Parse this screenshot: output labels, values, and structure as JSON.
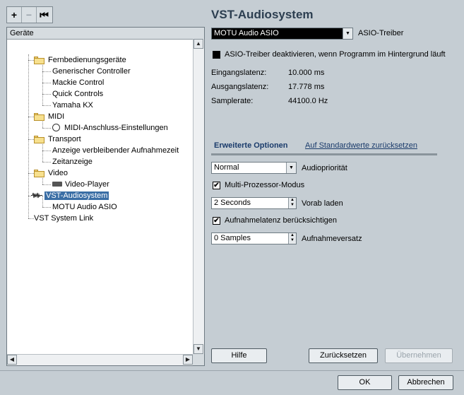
{
  "toolbar": {
    "add": "+",
    "remove": "−",
    "reset": "⏮"
  },
  "tree": {
    "header": "Geräte",
    "items": [
      {
        "label": "Fernbedienungsgeräte"
      },
      {
        "label": "Generischer Controller"
      },
      {
        "label": "Mackie Control"
      },
      {
        "label": "Quick Controls"
      },
      {
        "label": "Yamaha KX"
      },
      {
        "label": "MIDI"
      },
      {
        "label": "MIDI-Anschluss-Einstellungen"
      },
      {
        "label": "Transport"
      },
      {
        "label": "Anzeige verbleibender Aufnahmezeit"
      },
      {
        "label": "Zeitanzeige"
      },
      {
        "label": "Video"
      },
      {
        "label": "Video-Player"
      },
      {
        "label": "VST-Audiosystem"
      },
      {
        "label": "MOTU Audio ASIO"
      },
      {
        "label": "VST System Link"
      }
    ]
  },
  "main": {
    "title": "VST-Audiosystem",
    "driver_value": "MOTU Audio ASIO",
    "driver_label": "ASIO-Treiber",
    "deactivate_label": "ASIO-Treiber deaktivieren, wenn Programm im Hintergrund läuft",
    "input_latency_label": "Eingangslatenz:",
    "input_latency_value": "10.000 ms",
    "output_latency_label": "Ausgangslatenz:",
    "output_latency_value": "17.778 ms",
    "samplerate_label": "Samplerate:",
    "samplerate_value": "44100.0 Hz",
    "advanced_tab": "Erweiterte Optionen",
    "defaults_link": "Auf Standardwerte zurücksetzen",
    "priority_value": "Normal",
    "priority_label": "Audiopriorität",
    "multiproc_label": "Multi-Prozessor-Modus",
    "preload_value": "2 Seconds",
    "preload_label": "Vorab laden",
    "reclatency_label": "Aufnahmelatenz berücksichtigen",
    "offset_value": "0 Samples",
    "offset_label": "Aufnahmeversatz",
    "help_button": "Hilfe",
    "reset_button": "Zurücksetzen",
    "apply_button": "Übernehmen"
  },
  "footer": {
    "ok": "OK",
    "cancel": "Abbrechen"
  }
}
